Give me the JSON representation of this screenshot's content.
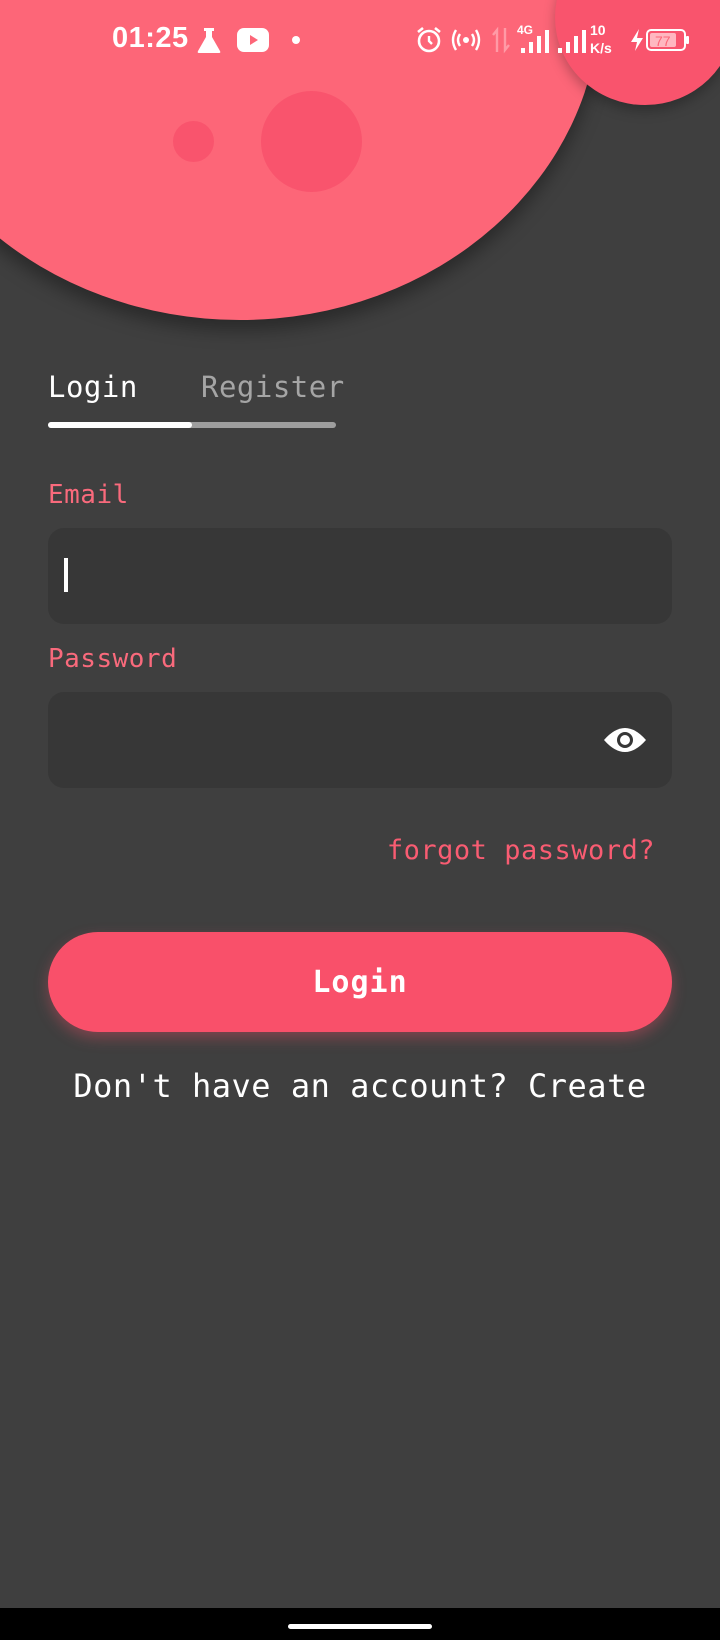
{
  "status_bar": {
    "time": "01:25",
    "network_type": "4G",
    "speed_value": "10",
    "speed_unit": "K/s",
    "battery_level": "77",
    "icons": [
      "flask-icon",
      "youtube-icon",
      "dot-icon",
      "alarm-icon",
      "hotspot-icon",
      "data-arrows-icon",
      "signal-icon",
      "signal-icon",
      "charging-icon",
      "battery-icon"
    ]
  },
  "tabs": {
    "login_label": "Login",
    "register_label": "Register",
    "active": "Login"
  },
  "form": {
    "email_label": "Email",
    "email_value": "",
    "password_label": "Password",
    "password_value": "",
    "password_toggle_icon": "eye-icon"
  },
  "forgot_password_label": "forgot password?",
  "login_button_label": "Login",
  "signup_prompt": "Don't have an account?",
  "signup_link": "Create",
  "colors": {
    "background": "#3f3f3f",
    "accent": "#f9506a",
    "accent_light": "#fd6678",
    "label": "#f96a7c",
    "field": "#373737"
  }
}
